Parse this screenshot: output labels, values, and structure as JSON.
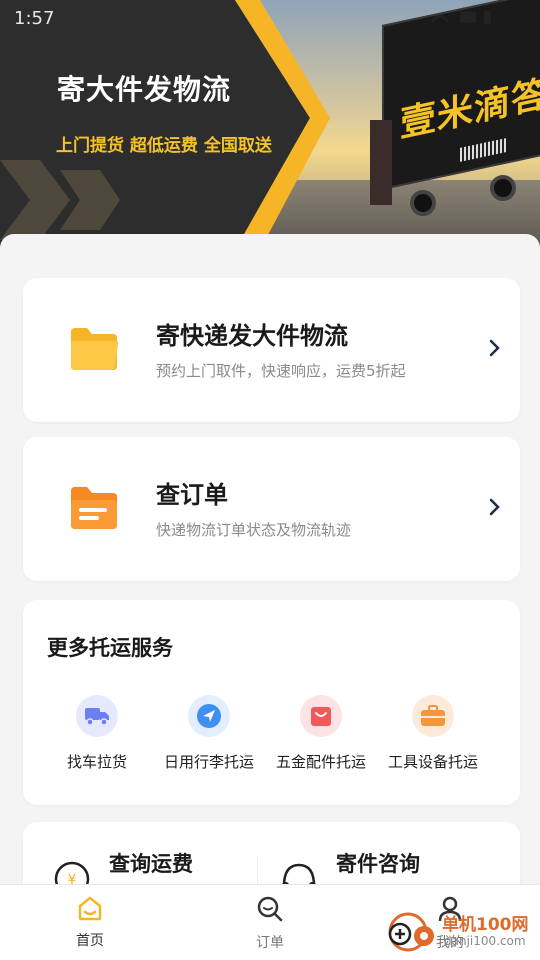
{
  "status_bar": {
    "time": "1:57"
  },
  "banner": {
    "title": "寄大件发物流",
    "subtitle": "上门提货 超低运费 全国取送",
    "truck_logo": "壹米滴答"
  },
  "cards": [
    {
      "title": "寄快递发大件物流",
      "desc": "预约上门取件，快速响应，运费5折起",
      "icon": "folder-icon"
    },
    {
      "title": "查订单",
      "desc": "快递物流订单状态及物流轨迹",
      "icon": "document-folder-icon"
    }
  ],
  "services": {
    "heading": "更多托运服务",
    "items": [
      {
        "label": "找车拉货",
        "icon": "truck-icon",
        "color": "#6b7ff0"
      },
      {
        "label": "日用行李托运",
        "icon": "navigation-icon",
        "color": "#3f8ff0"
      },
      {
        "label": "五金配件托运",
        "icon": "shopping-bag-icon",
        "color": "#f25a5a"
      },
      {
        "label": "工具设备托运",
        "icon": "toolbox-icon",
        "color": "#f5963a"
      }
    ]
  },
  "bottom": {
    "left_title": "查询运费",
    "right_title": "寄件咨询",
    "left_icon": "yuan-icon",
    "right_icon": "headset-icon"
  },
  "tabbar": {
    "tabs": [
      {
        "label": "首页",
        "icon": "home-icon",
        "active": true
      },
      {
        "label": "订单",
        "icon": "search-icon",
        "active": false
      },
      {
        "label": "我的",
        "icon": "user-icon",
        "active": false
      }
    ]
  },
  "watermark": {
    "title": "单机100网",
    "url": "danji100.com"
  },
  "colors": {
    "accent": "#f6b526",
    "banner_dark": "#2d2d2d",
    "card_bg": "#ffffff",
    "page_bg": "#f4f4f4"
  }
}
